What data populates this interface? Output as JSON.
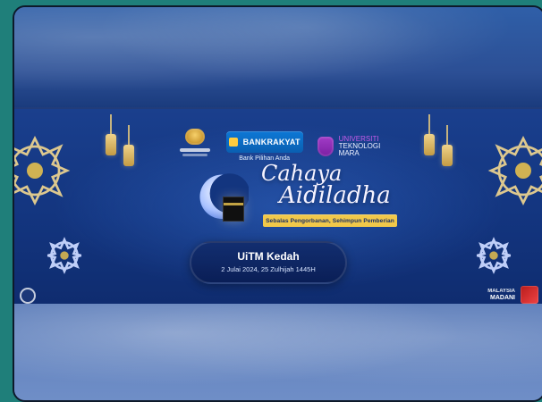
{
  "banner": {
    "logos": {
      "bank_name": "BANKRAKYAT",
      "bank_tagline": "Bank Pilihan Anda",
      "uitm_lines": [
        "UNIVERSITI",
        "TEKNOLOGI",
        "MARA"
      ]
    },
    "title_line1": "Cahaya",
    "title_line2": "Aidiladha",
    "subtitle": "Sebalas Pengorbanan, Sehimpun Pemberian",
    "location": "UiTM Kedah",
    "date": "2 Julai 2024, 25 Zulhijah 1445H",
    "footer_right_lines": [
      "MALAYSIA",
      "MADANI"
    ]
  },
  "colors": {
    "teal_background": "#1f7f7a",
    "banner_blue": "#13357f",
    "gold": "#f1c84a"
  },
  "icons": {
    "moon": "crescent-moon-icon",
    "kaaba": "kaaba-icon",
    "lantern": "lantern-icon",
    "ornament": "islamic-star-ornament-icon"
  }
}
